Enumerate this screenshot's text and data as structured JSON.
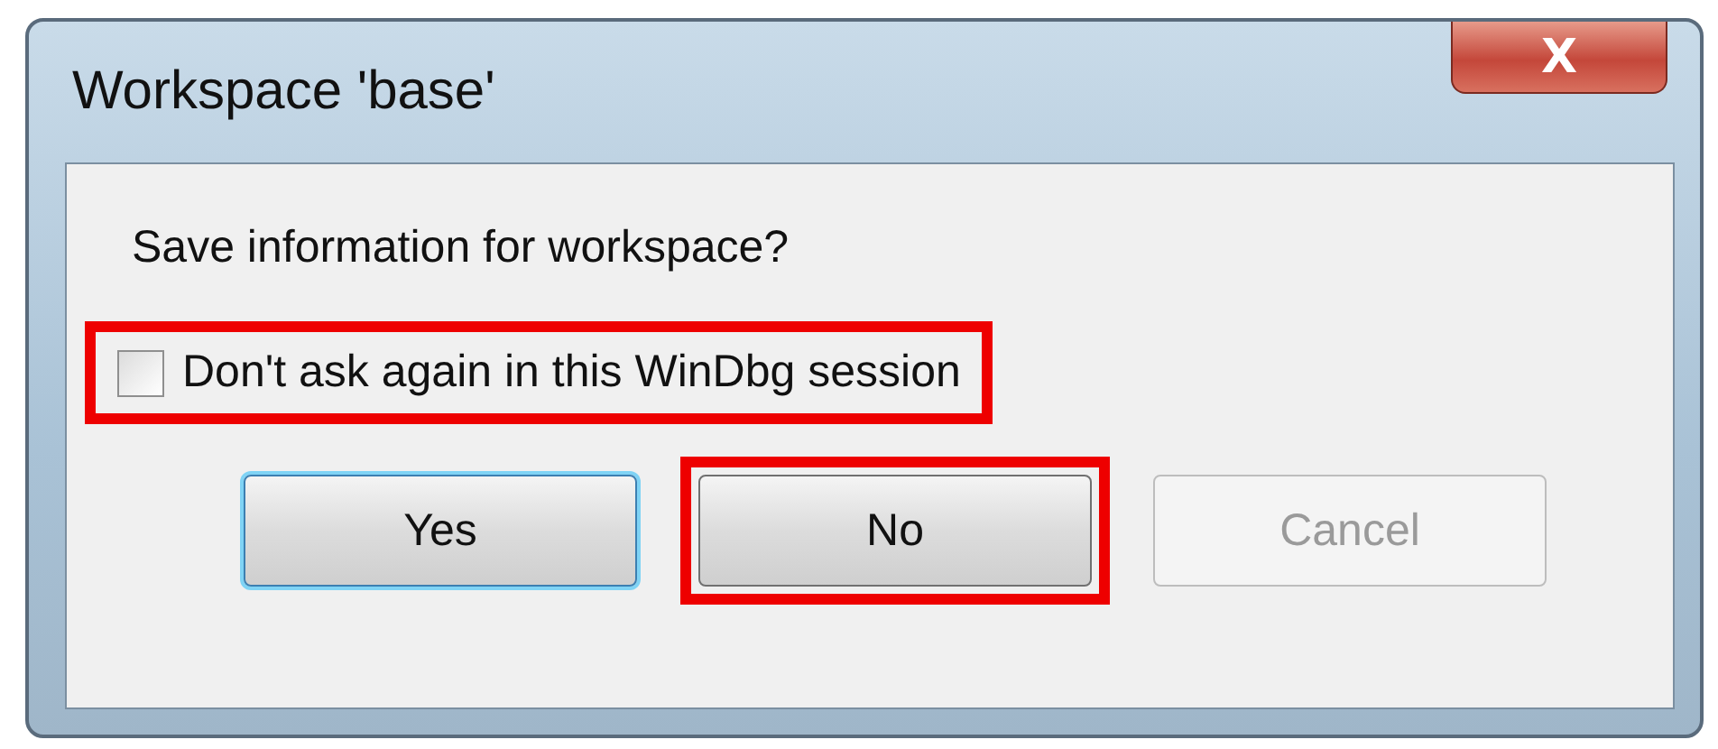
{
  "window": {
    "title": "Workspace 'base'",
    "close_label": "X"
  },
  "message": "Save information for workspace?",
  "checkbox": {
    "label": "Don't ask again in this WinDbg session",
    "checked": false,
    "highlighted": true
  },
  "buttons": [
    {
      "label": "Yes",
      "focused": true,
      "disabled": false,
      "highlighted": false
    },
    {
      "label": "No",
      "focused": false,
      "disabled": false,
      "highlighted": true
    },
    {
      "label": "Cancel",
      "focused": false,
      "disabled": true,
      "highlighted": false
    }
  ]
}
